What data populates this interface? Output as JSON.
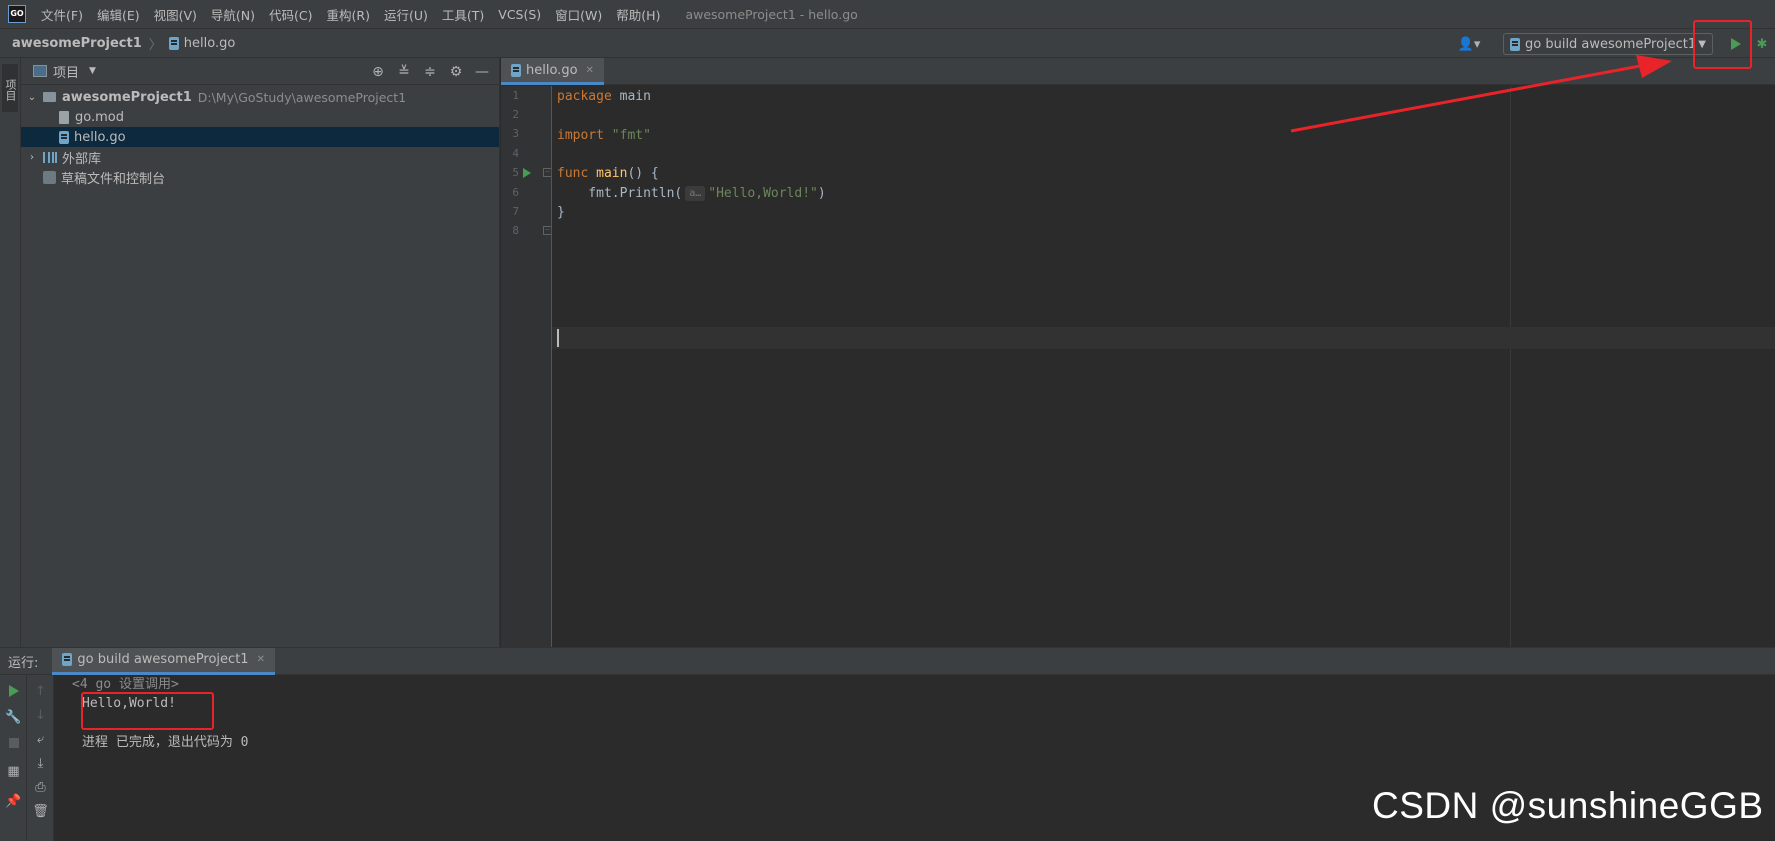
{
  "app": {
    "logo_text": "GO",
    "window_title": "awesomeProject1 - hello.go"
  },
  "menu": [
    "文件(F)",
    "编辑(E)",
    "视图(V)",
    "导航(N)",
    "代码(C)",
    "重构(R)",
    "运行(U)",
    "工具(T)",
    "VCS(S)",
    "窗口(W)",
    "帮助(H)"
  ],
  "breadcrumb": {
    "project": "awesomeProject1",
    "file": "hello.go"
  },
  "toolbar": {
    "run_config": "go build awesomeProject1",
    "run_icon": "play-icon",
    "debug_icon": "bug-icon"
  },
  "side_strip": {
    "tab_label": "项目"
  },
  "project_panel": {
    "title": "项目",
    "tree": {
      "root_name": "awesomeProject1",
      "root_path": "D:\\My\\GoStudy\\awesomeProject1",
      "go_mod": "go.mod",
      "hello_go": "hello.go",
      "external_libs": "外部库",
      "scratches": "草稿文件和控制台"
    }
  },
  "editor": {
    "tab_label": "hello.go",
    "line_numbers": [
      "1",
      "2",
      "3",
      "4",
      "5",
      "6",
      "7",
      "8"
    ],
    "code": {
      "l1_kw": "package",
      "l1_name": " main",
      "l3_kw": "import",
      "l3_str": " \"fmt\"",
      "l5_kw": "func",
      "l5_fn": " main",
      "l5_rest": "() {",
      "l6_indent": "    fmt.Println(",
      "l6_hint": "a…",
      "l6_str": "\"Hello,World!\"",
      "l6_end": ")",
      "l7": "}"
    }
  },
  "run_panel": {
    "label": "运行:",
    "tab": "go build awesomeProject1",
    "console": {
      "header": "<4 go 设置调用>",
      "output": "Hello,World!",
      "exit": "进程 已完成，退出代码为 0"
    }
  },
  "watermark": "CSDN @sunshineGGB",
  "colors": {
    "annotation_red": "#e8242a",
    "run_green": "#499c54",
    "selection": "#0d293e"
  }
}
